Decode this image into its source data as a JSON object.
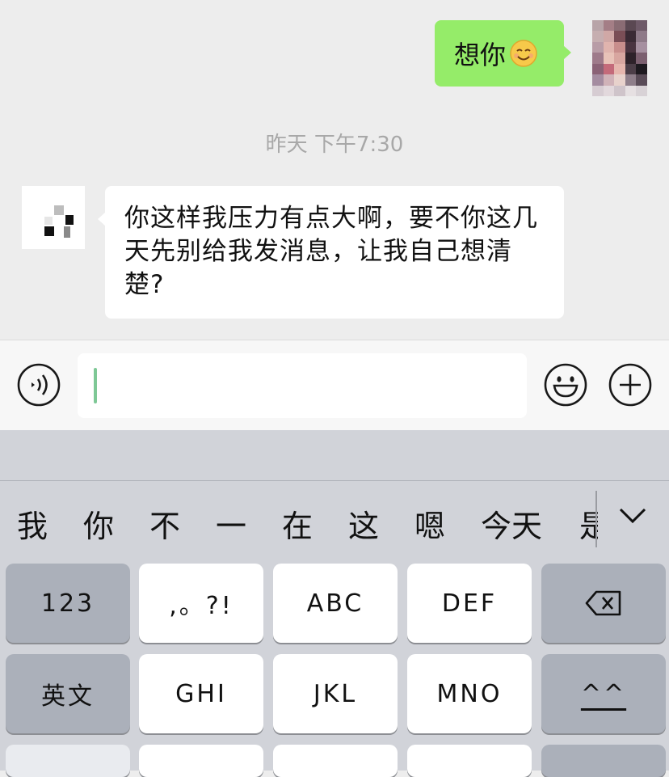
{
  "chat": {
    "outgoing_message": "想你",
    "timestamp": "昨天 下午7:30",
    "incoming_message": "你这样我压力有点大啊，要不你这几天先别给我发消息，让我自己想清楚?"
  },
  "input_bar": {
    "value": "",
    "icons": {
      "voice": "voice-icon",
      "emoji": "emoji-icon",
      "more": "plus-icon"
    }
  },
  "keyboard": {
    "candidates": [
      "我",
      "你",
      "不",
      "一",
      "在",
      "这",
      "嗯",
      "今天",
      "是"
    ],
    "expand_icon": "chevron-down-icon",
    "rows": [
      [
        {
          "label": "123",
          "style": "dark"
        },
        {
          "label": ",。?!",
          "style": "light"
        },
        {
          "label": "ABC",
          "style": "light"
        },
        {
          "label": "DEF",
          "style": "light"
        },
        {
          "label": "",
          "icon": "backspace-icon",
          "style": "dark"
        }
      ],
      [
        {
          "label": "英文",
          "style": "dark"
        },
        {
          "label": "GHI",
          "style": "light"
        },
        {
          "label": "JKL",
          "style": "light"
        },
        {
          "label": "MNO",
          "style": "light"
        },
        {
          "label": "^^",
          "style": "dark"
        }
      ]
    ]
  },
  "colors": {
    "outgoing_bubble": "#95ec69",
    "chat_background": "#ededed",
    "caret": "#7ec896",
    "keyboard_background": "#d1d3d9"
  }
}
